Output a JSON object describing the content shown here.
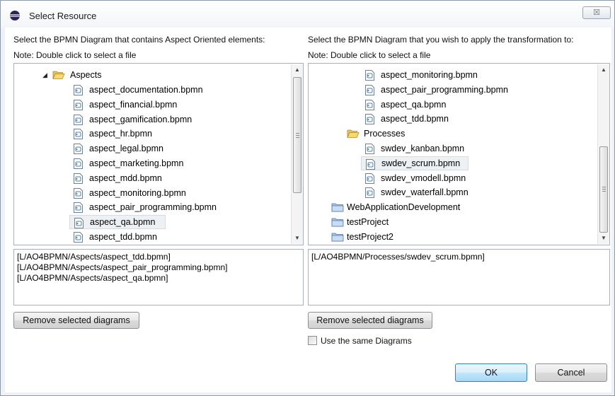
{
  "window": {
    "title": "Select Resource",
    "close_glyph": "☒"
  },
  "left": {
    "prompt": "Select the BPMN Diagram that contains Aspect Oriented elements:",
    "note": "Note: Double click to select a file",
    "folder": "Aspects",
    "files": [
      "aspect_documentation.bpmn",
      "aspect_financial.bpmn",
      "aspect_gamification.bpmn",
      "aspect_hr.bpmn",
      "aspect_legal.bpmn",
      "aspect_marketing.bpmn",
      "aspect_mdd.bpmn",
      "aspect_monitoring.bpmn",
      "aspect_pair_programming.bpmn",
      "aspect_qa.bpmn",
      "aspect_tdd.bpmn"
    ],
    "selected_index": 9,
    "selected_list": [
      "[L/AO4BPMN/Aspects/aspect_tdd.bpmn]",
      "[L/AO4BPMN/Aspects/aspect_pair_programming.bpmn]",
      "[L/AO4BPMN/Aspects/aspect_qa.bpmn]"
    ],
    "remove_label": "Remove selected diagrams"
  },
  "right": {
    "prompt": "Select the BPMN Diagram that you wish to apply the transformation to:",
    "note": "Note: Double click to select a file",
    "aspect_files": [
      "aspect_monitoring.bpmn",
      "aspect_pair_programming.bpmn",
      "aspect_qa.bpmn",
      "aspect_tdd.bpmn"
    ],
    "processes_folder": "Processes",
    "process_files": [
      "swdev_kanban.bpmn",
      "swdev_scrum.bpmn",
      "swdev_vmodell.bpmn",
      "swdev_waterfall.bpmn"
    ],
    "selected_process_index": 1,
    "projects": [
      "WebApplicationDevelopment",
      "testProject",
      "testProject2"
    ],
    "selected_list": [
      "[L/AO4BPMN/Processes/swdev_scrum.bpmn]"
    ],
    "remove_label": "Remove selected diagrams"
  },
  "same_diagrams_label": "Use the same Diagrams",
  "same_diagrams_checked": false,
  "ok_label": "OK",
  "cancel_label": "Cancel",
  "icons": {
    "title": "eclipse-icon",
    "file": "bpmn-file-icon",
    "folder_open": "open-folder-icon",
    "project": "project-folder-icon"
  }
}
